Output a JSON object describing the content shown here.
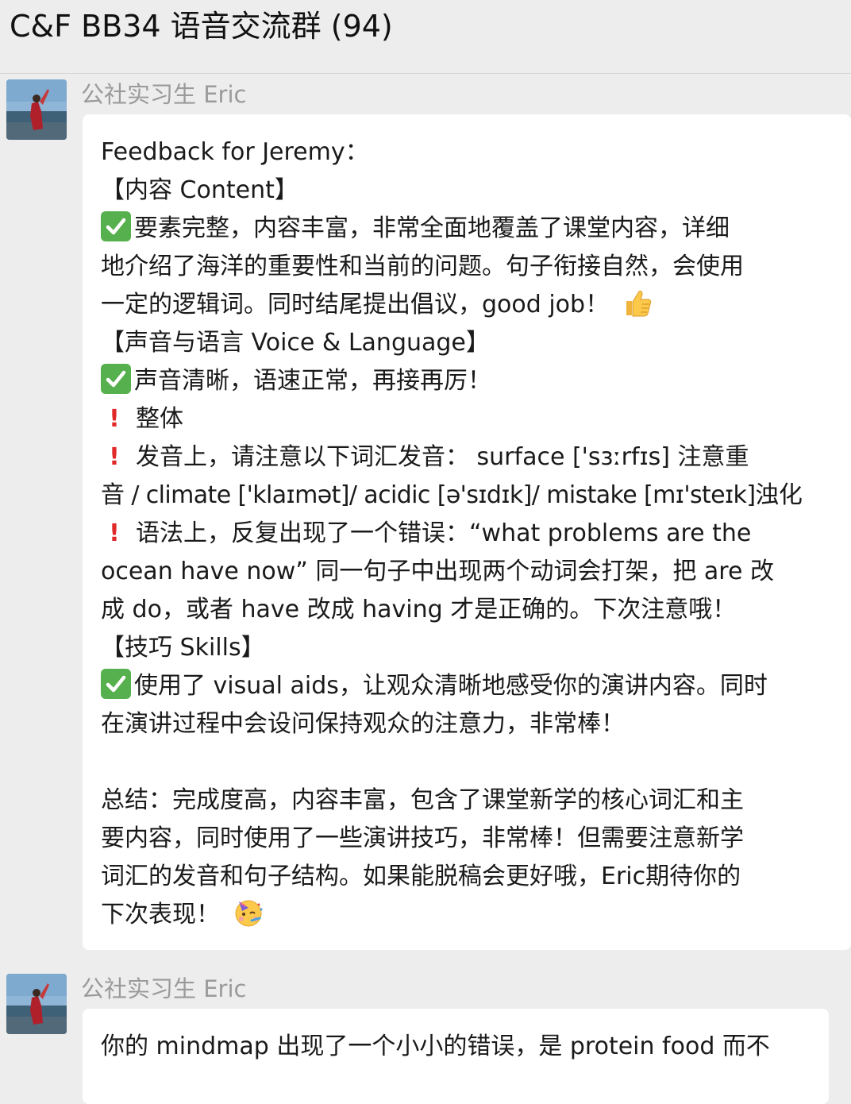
{
  "header": {
    "title": "C&F BB34 语音交流群 (94)"
  },
  "messages": [
    {
      "sender": "公社实习生 Eric",
      "lines": {
        "l1": "Feedback for Jeremy：",
        "l2": "【内容 Content】",
        "l3": "要素完整，内容丰富，非常全面地覆盖了课堂内容，详细",
        "l4": "地介绍了海洋的重要性和当前的问题。句子衔接自然，会使用",
        "l5": "一定的逻辑词。同时结尾提出倡议，good job！",
        "l6": "【声音与语言 Voice & Language】",
        "l7": "声音清晰，语速正常，再接再厉！",
        "l8": "整体",
        "l9": "发音上，请注意以下词汇发音：  surface ['sɜːrfɪs] 注意重",
        "l10": "音 / climate ['klaɪmət]/ acidic [ə'sɪdɪk]/ mistake [mɪ'steɪk]浊化",
        "l11": "语法上，反复出现了一个错误：“what problems are the",
        "l12": "ocean have now” 同一句子中出现两个动词会打架，把 are 改",
        "l13": "成 do，或者 have 改成 having 才是正确的。下次注意哦！",
        "l14": "【技巧 Skills】",
        "l15": "使用了 visual aids，让观众清晰地感受你的演讲内容。同时",
        "l16": "在演讲过程中会设问保持观众的注意力，非常棒！",
        "l17": "总结：完成度高，内容丰富，包含了课堂新学的核心词汇和主",
        "l18": "要内容，同时使用了一些演讲技巧，非常棒！但需要注意新学",
        "l19": "词汇的发音和句子结构。如果能脱稿会更好哦，Eric期待你的",
        "l20": "下次表现！"
      },
      "icons": {
        "check": "white-heavy-check-mark-icon",
        "bang": "exclamation-mark-icon",
        "thumbs": "thumbs-up-icon",
        "party": "partying-face-icon"
      }
    },
    {
      "sender": "公社实习生 Eric",
      "lines": {
        "l1": "你的 mindmap 出现了一个小小的错误，是 protein food 而不"
      }
    }
  ],
  "colors": {
    "background": "#ededed",
    "bubble": "#ffffff",
    "check": "#55b04d",
    "bang": "#e02a2a",
    "sender": "#9a9a9a"
  }
}
